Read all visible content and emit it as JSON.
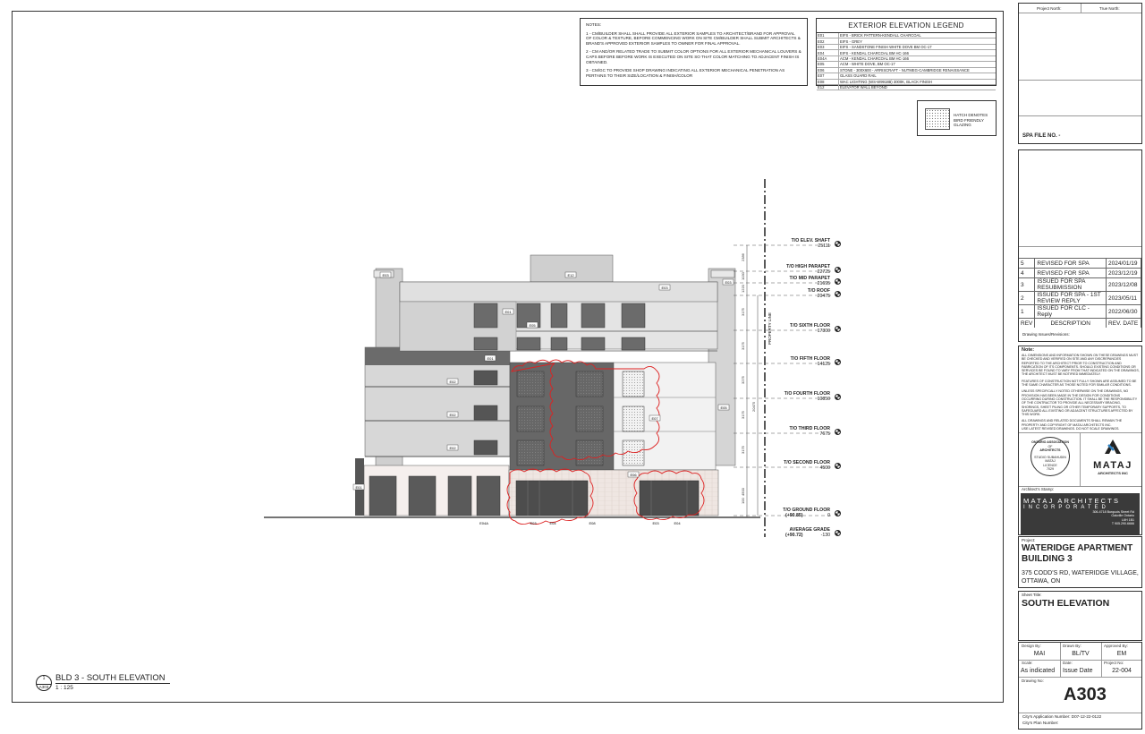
{
  "notes": {
    "title": "NOTES:",
    "items": [
      "1 - CM/BUILDER SHALL SHALL PROVIDE ALL EXTERIOR SAMPLES TO ARCHITECT/BRAND FOR APPROVAL OF COLOR & TEXTURE, BEFORE COMMENCING WORK ON SITE CM/BUILDER SHALL SUBMIT ARCHITECTS & BRAND'S APPROVED EXTERIOR SAMPLES TO OWNER FOR FINAL APPROVAL.",
      "2 - CM AND/OR RELATED TRADE TO SUBMIT COLOR OPTIONS FOR ALL EXTERIOR MECHANICAL LOUVERS & CAPS BEFORE BEFORE WORK IS EXECUTED ON SITE SO THAT COLOR MATCHING TO ADJACENT FINISH IS OBTAINED.",
      "3 - CM/GC TO PROVIDE SHOP DRAWING INDICATING ALL EXTERIOR MECHANICAL PENETRATION AS PERTAINS TO THEIR SIZE/LOCATION & FINISH/COLOR"
    ]
  },
  "legend": {
    "title": "EXTERIOR ELEVATION LEGEND",
    "rows": [
      {
        "code": "E01",
        "desc": "EIFS - BRICK PATTERN-KENDALL CHARCOAL"
      },
      {
        "code": "E02",
        "desc": "EIFS - GREY"
      },
      {
        "code": "E03",
        "desc": "EIFS - SANDSTONE FINISH WHITE DOVE BM OC-17"
      },
      {
        "code": "E04",
        "desc": "EIFS - KENDAL CHARCOAL BM HC-166"
      },
      {
        "code": "E04A",
        "desc": "ACM - KENDAL CHARCOAL BM HC-166"
      },
      {
        "code": "E05",
        "desc": "ACM - WHITE DOVE, BM OC-17"
      },
      {
        "code": "E06",
        "desc": "STONE - 300X600 - ARRISCRAFT - NUTMEG-CAMBRIDGE RENAISSANCE"
      },
      {
        "code": "E07",
        "desc": "GLASS GUARD RAIL"
      },
      {
        "code": "E08",
        "desc": "WAC LIGHTING (WS-W9918B) 3000K, BLACK FINISH"
      },
      {
        "code": "E12",
        "desc": "ELEVATOR WALL BEYOND"
      }
    ]
  },
  "hatch_note": "HATCH DENOTES BIRD FRIENDLY GLAZING",
  "levels": [
    {
      "name": "T/O ELEV. SHAFT",
      "elev": "25111"
    },
    {
      "name": "T/O HIGH PARAPET",
      "elev": "22725"
    },
    {
      "name": "T/O MID PARAPET",
      "elev": "21695"
    },
    {
      "name": "T/O ROOF",
      "elev": "20475"
    },
    {
      "name": "T/O SIXTH FLOOR",
      "elev": "17300"
    },
    {
      "name": "T/O FIFTH FLOOR",
      "elev": "14125"
    },
    {
      "name": "T/O FOURTH FLOOR",
      "elev": "10850"
    },
    {
      "name": "T/O THIRD FLOOR",
      "elev": "7675"
    },
    {
      "name": "T/O SECOND FLOOR",
      "elev": "4500"
    },
    {
      "name": "T/O GROUND FLOOR",
      "elev": "0",
      "extra": "(+90.85)"
    },
    {
      "name": "AVERAGE GRADE",
      "elev": "-130",
      "extra": "(+90.72)"
    }
  ],
  "dims": [
    "2386",
    "1030",
    "1220",
    "3175",
    "3175",
    "3275",
    "3175",
    "3175",
    "4500",
    "20475",
    "100"
  ],
  "property_line": "PROPERTY LINE",
  "tags": {
    "e01": "E01",
    "e02": "E02",
    "e03": "E03",
    "e04": "E04",
    "e04a": "E04A",
    "e05": "E05",
    "e06": "E06",
    "e07": "E07",
    "e08": "E08",
    "e12": "E12"
  },
  "view": {
    "number": "1",
    "sheet": "A303",
    "title": "BLD 3 - SOUTH ELEVATION",
    "scale": "1 : 125"
  },
  "titleblock": {
    "project_north": "Project North:",
    "true_north": "True North:",
    "spa_file": "SPA FILE NO. -",
    "revisions": [
      {
        "no": "5",
        "desc": "REVISED FOR SPA",
        "date": "2024/01/19"
      },
      {
        "no": "4",
        "desc": "REVISED FOR SPA",
        "date": "2023/12/19"
      },
      {
        "no": "3",
        "desc": "ISSUED FOR SPA RESUBMISSION",
        "date": "2023/12/08"
      },
      {
        "no": "2",
        "desc": "ISSUED FOR SPA - 1ST REVIEW REPLY",
        "date": "2023/05/11"
      },
      {
        "no": "1",
        "desc": "ISSUED FOR CLC - Reply",
        "date": "2022/06/30"
      }
    ],
    "rev_header": {
      "no": "REV",
      "desc": "DESCRIPTION",
      "date": "REV. DATE"
    },
    "drawing_issues": "Drawing Issues/Revisions:",
    "note_title": "Note:",
    "note_paras": [
      "ALL DIMENSIONS AND INFORMATION SHOWN ON THESE DRAWINGS MUST BE CHECKED AND VERIFIED ON SITE AND ANY DISCREPANCIES REPORTED TO THE ARCHITECT PRIOR TO CONSTRUCTION AND FABRICATION OF ITS COMPONENTS. SHOULD EXISTING CONDITIONS OR SERVICES BE FOUND TO VARY FROM THAT INDICATED ON THE DRAWINGS, THE ARCHITECT MUST BE NOTIFIED IMMEDIATELY.",
      "FEATURES OF CONSTRUCTION NOT FULLY SHOWN ARE ASSUMED TO BE THE SAME CHARACTER AS THOSE NOTED FOR SIMILAR CONDITIONS.",
      "UNLESS SPECIFICALLY NOTED OTHERWISE ON THE DRAWINGS, NO PROVISION HAS BEEN MADE IN THE DESIGN FOR CONDITIONS OCCURRING DURING CONSTRUCTION. IT SHALL BE THE RESPONSIBILITY OF THE CONTRACTOR TO PROVIDE ALL NECESSARY BRACING, SHORINGS, SHEET PILING OR OTHER TEMPORARY SUPPORTS, TO SAFEGUARD ALL EXISTING OR ADJACENT STRUCTURES AFFECTED BY THIS WORK.",
      "ALL DRAWINGS AND RELATED DOCUMENTS SHALL REMAIN THE PROPERTY AND COPYRIGHT OF MATAJ ARCHITECTS INC.",
      "USE LATEST REVISED DRAWINGS.  DO NOT SCALE DRAWINGS."
    ],
    "seal": {
      "top": "ONTARIO ASSOCIATION",
      "of": "OF",
      "arch": "ARCHITECTS",
      "name": "STUDIO SUBAHUDIN MATAJ",
      "lic": "LICENCE",
      "num": "7029"
    },
    "logo": {
      "name": "MATAJ",
      "sub": "ARCHITECTS INC"
    },
    "architect_stamp": "Architect's Stamp:",
    "firm": {
      "line1": "MATAJ ARCHITECTS",
      "line2": "INCORPORATED",
      "addr1": "306-4718 Burquois Street Rd",
      "addr2": "Oakville Ontario",
      "addr3": "L6H 1B1",
      "phone": "T 905.290.6666"
    },
    "project_label": "Project:",
    "project_name": "WATERIDGE APARTMENT BUILDING 3",
    "project_addr": "375 CODD'S RD, WATERIDGE VILLAGE, OTTAWA, ON",
    "sheet_title_label": "Sheet Title:",
    "sheet_title": "SOUTH ELEVATION",
    "design_by_label": "Design By:",
    "design_by": "MAI",
    "drawn_by_label": "Drawn By:",
    "drawn_by": "BL/TV",
    "approved_by_label": "Approved By:",
    "approved_by": "EM",
    "scale_label": "Scale:",
    "scale": "As indicated",
    "date_label": "Date:",
    "date": "Issue Date",
    "project_no_label": "Project No:",
    "project_no": "22-004",
    "drawing_no_label": "Drawing No:",
    "drawing_no": "A303",
    "app_number": "City's Application Number: D07-12-22-0122",
    "plan_number": "City's Plan Number:"
  }
}
